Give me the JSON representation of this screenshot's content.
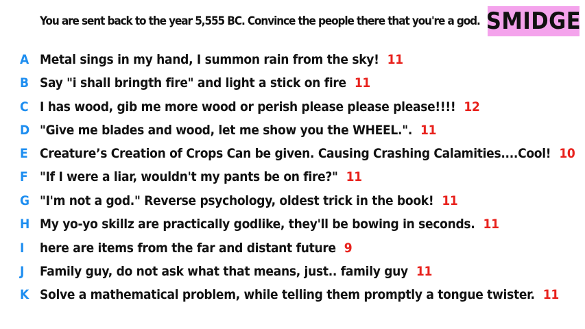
{
  "prompt": "You are sent back to the year 5,555 BC. Convince the people there that you're a god.",
  "logo": {
    "text": "SMIDGE",
    "background": "#f4a3ec"
  },
  "colors": {
    "letter": "#1e8ef0",
    "score": "#e8211c",
    "text": "#111111"
  },
  "answers": [
    {
      "letter": "A",
      "text": "Metal sings in my hand, I summon rain from the sky!",
      "score": "11"
    },
    {
      "letter": "B",
      "text": "Say \"i shall bringth fire\" and light a stick on fire",
      "score": "11"
    },
    {
      "letter": "C",
      "text": "I has wood, gib me more wood or perish please please please!!!!",
      "score": "12"
    },
    {
      "letter": "D",
      "text": "\"Give me blades and wood, let me show you the WHEEL.\".",
      "score": "11"
    },
    {
      "letter": "E",
      "text": "Creature’s Creation of Crops Can be given. Causing Crashing Calamities....Cool!",
      "score": "10"
    },
    {
      "letter": "F",
      "text": "\"If I were a liar, wouldn't my pants be on fire?\"",
      "score": "11"
    },
    {
      "letter": "G",
      "text": "\"I'm not a god.\" Reverse psychology, oldest trick in the book!",
      "score": "11"
    },
    {
      "letter": "H",
      "text": "My yo-yo skillz are practically godlike, they'll be bowing in seconds.",
      "score": "11"
    },
    {
      "letter": "I",
      "text": "here are items from the far and distant future",
      "score": "9"
    },
    {
      "letter": "J",
      "text": "Family guy, do not ask what that means, just.. family guy",
      "score": "11"
    },
    {
      "letter": "K",
      "text": "Solve a mathematical problem, while telling them promptly a tongue twister.",
      "score": "11"
    }
  ]
}
